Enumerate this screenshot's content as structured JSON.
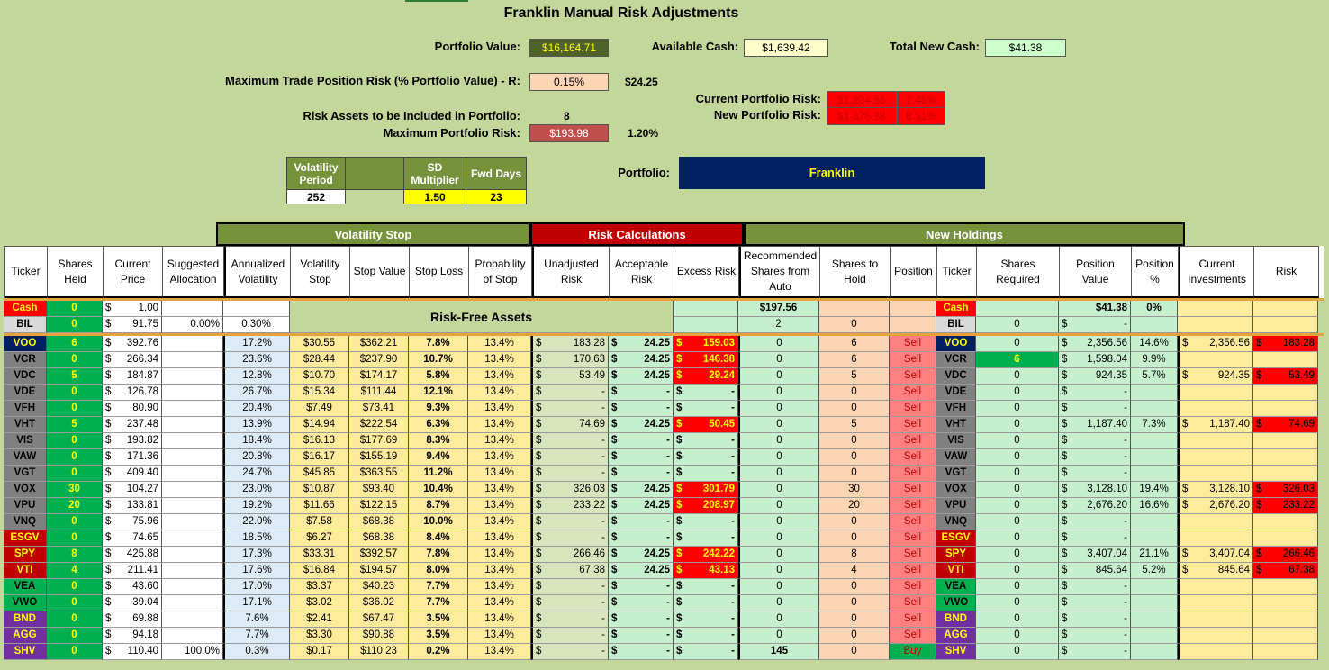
{
  "title": "Franklin Manual Risk Adjustments",
  "summary": {
    "portfolio_value_label": "Portfolio Value:",
    "portfolio_value": "$16,164.71",
    "available_cash_label": "Available Cash:",
    "available_cash": "$1,639.42",
    "total_new_cash_label": "Total New Cash:",
    "total_new_cash": "$41.38",
    "max_trade_label": "Maximum Trade Position Risk (% Portfolio Value) - R:",
    "max_trade_pct": "0.15%",
    "max_trade_amt": "$24.25",
    "current_risk_label": "Current Portfolio Risk:",
    "current_risk_amt": "$1,204.56",
    "current_risk_pct": "7.45%",
    "new_risk_label": "New Portfolio Risk:",
    "new_risk_amt": "$1,375.18",
    "new_risk_pct": "8.51%",
    "risk_assets_label": "Risk Assets to be Included in Portfolio:",
    "risk_assets": "8",
    "max_portfolio_risk_label": "Maximum Portfolio Risk:",
    "max_portfolio_risk": "$193.98",
    "max_portfolio_risk_pct": "1.20%",
    "portfolio_label": "Portfolio:",
    "portfolio_name": "Franklin"
  },
  "vol_table": {
    "h1": "Volatility Period",
    "h2": "",
    "h3": "SD Multiplier",
    "h4": "Fwd Days",
    "v1": "252",
    "v3": "1.50",
    "v4": "23"
  },
  "groups": {
    "vol_stop": "Volatility Stop",
    "risk_calc": "Risk Calculations",
    "new_holdings": "New Holdings"
  },
  "headers": [
    "Ticker",
    "Shares Held",
    "Current Price",
    "Suggested Allocation",
    "Annualized Volatility",
    "Volatility Stop",
    "Stop Value",
    "Stop Loss",
    "Probability of Stop",
    "Unadjusted Risk",
    "Acceptable Risk",
    "Excess Risk",
    "Recommended Shares from Auto",
    "Shares to Hold",
    "Position",
    "Ticker",
    "Shares Required",
    "Position Value",
    "Position %",
    "Current Investments",
    "Risk"
  ],
  "risk_free": {
    "label": "Risk-Free Assets",
    "cash": {
      "ticker": "Cash",
      "held": "0",
      "price": "1.00",
      "rec": "$197.56",
      "ticker2": "Cash",
      "pos_value": "$41.38",
      "pos_pct": "0%"
    },
    "bil": {
      "ticker": "BIL",
      "held": "0",
      "price": "91.75",
      "alloc": "0.00%",
      "vol": "0.30%",
      "rec": "2",
      "hold": "0",
      "ticker2": "BIL",
      "req": "0",
      "pos_value": "-"
    }
  },
  "rows": [
    {
      "t": "VOO",
      "held": "6",
      "price": "392.76",
      "vol": "17.2%",
      "vstop": "$30.55",
      "sval": "$362.21",
      "sloss": "7.8%",
      "prob": "13.4%",
      "unadj": "183.28",
      "acc": "24.25",
      "exc": "159.03",
      "rec": "0",
      "hold": "6",
      "pos": "Sell",
      "req": "0",
      "pval": "2,356.56",
      "ppct": "14.6%",
      "cur": "2,356.56",
      "risk": "183.28"
    },
    {
      "t": "VCR",
      "held": "0",
      "price": "266.34",
      "vol": "23.6%",
      "vstop": "$28.44",
      "sval": "$237.90",
      "sloss": "10.7%",
      "prob": "13.4%",
      "unadj": "170.63",
      "acc": "24.25",
      "exc": "146.38",
      "rec": "0",
      "hold": "6",
      "pos": "Sell",
      "req": "6",
      "pval": "1,598.04",
      "ppct": "9.9%",
      "cur": "",
      "risk": ""
    },
    {
      "t": "VDC",
      "held": "5",
      "price": "184.87",
      "vol": "12.8%",
      "vstop": "$10.70",
      "sval": "$174.17",
      "sloss": "5.8%",
      "prob": "13.4%",
      "unadj": "53.49",
      "acc": "24.25",
      "exc": "29.24",
      "rec": "0",
      "hold": "5",
      "pos": "Sell",
      "req": "0",
      "pval": "924.35",
      "ppct": "5.7%",
      "cur": "924.35",
      "risk": "53.49"
    },
    {
      "t": "VDE",
      "held": "0",
      "price": "126.78",
      "vol": "26.7%",
      "vstop": "$15.34",
      "sval": "$111.44",
      "sloss": "12.1%",
      "prob": "13.4%",
      "unadj": "-",
      "acc": "-",
      "exc": "-",
      "rec": "0",
      "hold": "0",
      "pos": "Sell",
      "req": "0",
      "pval": "-",
      "ppct": "",
      "cur": "",
      "risk": ""
    },
    {
      "t": "VFH",
      "held": "0",
      "price": "80.90",
      "vol": "20.4%",
      "vstop": "$7.49",
      "sval": "$73.41",
      "sloss": "9.3%",
      "prob": "13.4%",
      "unadj": "-",
      "acc": "-",
      "exc": "-",
      "rec": "0",
      "hold": "0",
      "pos": "Sell",
      "req": "0",
      "pval": "-",
      "ppct": "",
      "cur": "",
      "risk": ""
    },
    {
      "t": "VHT",
      "held": "5",
      "price": "237.48",
      "vol": "13.9%",
      "vstop": "$14.94",
      "sval": "$222.54",
      "sloss": "6.3%",
      "prob": "13.4%",
      "unadj": "74.69",
      "acc": "24.25",
      "exc": "50.45",
      "rec": "0",
      "hold": "5",
      "pos": "Sell",
      "req": "0",
      "pval": "1,187.40",
      "ppct": "7.3%",
      "cur": "1,187.40",
      "risk": "74.69"
    },
    {
      "t": "VIS",
      "held": "0",
      "price": "193.82",
      "vol": "18.4%",
      "vstop": "$16.13",
      "sval": "$177.69",
      "sloss": "8.3%",
      "prob": "13.4%",
      "unadj": "-",
      "acc": "-",
      "exc": "-",
      "rec": "0",
      "hold": "0",
      "pos": "Sell",
      "req": "0",
      "pval": "-",
      "ppct": "",
      "cur": "",
      "risk": ""
    },
    {
      "t": "VAW",
      "held": "0",
      "price": "171.36",
      "vol": "20.8%",
      "vstop": "$16.17",
      "sval": "$155.19",
      "sloss": "9.4%",
      "prob": "13.4%",
      "unadj": "-",
      "acc": "-",
      "exc": "-",
      "rec": "0",
      "hold": "0",
      "pos": "Sell",
      "req": "0",
      "pval": "-",
      "ppct": "",
      "cur": "",
      "risk": ""
    },
    {
      "t": "VGT",
      "held": "0",
      "price": "409.40",
      "vol": "24.7%",
      "vstop": "$45.85",
      "sval": "$363.55",
      "sloss": "11.2%",
      "prob": "13.4%",
      "unadj": "-",
      "acc": "-",
      "exc": "-",
      "rec": "0",
      "hold": "0",
      "pos": "Sell",
      "req": "0",
      "pval": "-",
      "ppct": "",
      "cur": "",
      "risk": ""
    },
    {
      "t": "VOX",
      "held": "30",
      "price": "104.27",
      "vol": "23.0%",
      "vstop": "$10.87",
      "sval": "$93.40",
      "sloss": "10.4%",
      "prob": "13.4%",
      "unadj": "326.03",
      "acc": "24.25",
      "exc": "301.79",
      "rec": "0",
      "hold": "30",
      "pos": "Sell",
      "req": "0",
      "pval": "3,128.10",
      "ppct": "19.4%",
      "cur": "3,128.10",
      "risk": "326.03"
    },
    {
      "t": "VPU",
      "held": "20",
      "price": "133.81",
      "vol": "19.2%",
      "vstop": "$11.66",
      "sval": "$122.15",
      "sloss": "8.7%",
      "prob": "13.4%",
      "unadj": "233.22",
      "acc": "24.25",
      "exc": "208.97",
      "rec": "0",
      "hold": "20",
      "pos": "Sell",
      "req": "0",
      "pval": "2,676.20",
      "ppct": "16.6%",
      "cur": "2,676.20",
      "risk": "233.22"
    },
    {
      "t": "VNQ",
      "held": "0",
      "price": "75.96",
      "vol": "22.0%",
      "vstop": "$7.58",
      "sval": "$68.38",
      "sloss": "10.0%",
      "prob": "13.4%",
      "unadj": "-",
      "acc": "-",
      "exc": "-",
      "rec": "0",
      "hold": "0",
      "pos": "Sell",
      "req": "0",
      "pval": "-",
      "ppct": "",
      "cur": "",
      "risk": ""
    },
    {
      "t": "ESGV",
      "held": "0",
      "price": "74.65",
      "vol": "18.5%",
      "vstop": "$6.27",
      "sval": "$68.38",
      "sloss": "8.4%",
      "prob": "13.4%",
      "unadj": "-",
      "acc": "-",
      "exc": "-",
      "rec": "0",
      "hold": "0",
      "pos": "Sell",
      "req": "0",
      "pval": "-",
      "ppct": "",
      "cur": "",
      "risk": ""
    },
    {
      "t": "SPY",
      "held": "8",
      "price": "425.88",
      "vol": "17.3%",
      "vstop": "$33.31",
      "sval": "$392.57",
      "sloss": "7.8%",
      "prob": "13.4%",
      "unadj": "266.46",
      "acc": "24.25",
      "exc": "242.22",
      "rec": "0",
      "hold": "8",
      "pos": "Sell",
      "req": "0",
      "pval": "3,407.04",
      "ppct": "21.1%",
      "cur": "3,407.04",
      "risk": "266.46"
    },
    {
      "t": "VTI",
      "held": "4",
      "price": "211.41",
      "vol": "17.6%",
      "vstop": "$16.84",
      "sval": "$194.57",
      "sloss": "8.0%",
      "prob": "13.4%",
      "unadj": "67.38",
      "acc": "24.25",
      "exc": "43.13",
      "rec": "0",
      "hold": "4",
      "pos": "Sell",
      "req": "0",
      "pval": "845.64",
      "ppct": "5.2%",
      "cur": "845.64",
      "risk": "67.38"
    },
    {
      "t": "VEA",
      "held": "0",
      "price": "43.60",
      "vol": "17.0%",
      "vstop": "$3.37",
      "sval": "$40.23",
      "sloss": "7.7%",
      "prob": "13.4%",
      "unadj": "-",
      "acc": "-",
      "exc": "-",
      "rec": "0",
      "hold": "0",
      "pos": "Sell",
      "req": "0",
      "pval": "-",
      "ppct": "",
      "cur": "",
      "risk": ""
    },
    {
      "t": "VWO",
      "held": "0",
      "price": "39.04",
      "vol": "17.1%",
      "vstop": "$3.02",
      "sval": "$36.02",
      "sloss": "7.7%",
      "prob": "13.4%",
      "unadj": "-",
      "acc": "-",
      "exc": "-",
      "rec": "0",
      "hold": "0",
      "pos": "Sell",
      "req": "0",
      "pval": "-",
      "ppct": "",
      "cur": "",
      "risk": ""
    },
    {
      "t": "BND",
      "held": "0",
      "price": "69.88",
      "vol": "7.6%",
      "vstop": "$2.41",
      "sval": "$67.47",
      "sloss": "3.5%",
      "prob": "13.4%",
      "unadj": "-",
      "acc": "-",
      "exc": "-",
      "rec": "0",
      "hold": "0",
      "pos": "Sell",
      "req": "0",
      "pval": "-",
      "ppct": "",
      "cur": "",
      "risk": ""
    },
    {
      "t": "AGG",
      "held": "0",
      "price": "94.18",
      "vol": "7.7%",
      "vstop": "$3.30",
      "sval": "$90.88",
      "sloss": "3.5%",
      "prob": "13.4%",
      "unadj": "-",
      "acc": "-",
      "exc": "-",
      "rec": "0",
      "hold": "0",
      "pos": "Sell",
      "req": "0",
      "pval": "-",
      "ppct": "",
      "cur": "",
      "risk": ""
    },
    {
      "t": "SHV",
      "held": "0",
      "price": "110.40",
      "alloc": "100.0%",
      "vol": "0.3%",
      "vstop": "$0.17",
      "sval": "$110.23",
      "sloss": "0.2%",
      "prob": "13.4%",
      "unadj": "-",
      "acc": "-",
      "exc": "-",
      "rec": "145",
      "hold": "0",
      "pos": "Buy",
      "req": "0",
      "pval": "-",
      "ppct": "",
      "cur": "",
      "risk": ""
    }
  ],
  "ticker_colors": {
    "VOO": "#002060",
    "VCR": "#808080",
    "VDC": "#808080",
    "VDE": "#808080",
    "VFH": "#808080",
    "VHT": "#808080",
    "VIS": "#808080",
    "VAW": "#808080",
    "VGT": "#808080",
    "VOX": "#808080",
    "VPU": "#808080",
    "VNQ": "#808080",
    "ESGV": "#c00000",
    "SPY": "#c00000",
    "VTI": "#c00000",
    "VEA": "#00b050",
    "VWO": "#00b050",
    "BND": "#7030a0",
    "AGG": "#7030a0",
    "SHV": "#7030a0"
  },
  "colors": {
    "background": "#c4d79b",
    "red": "#ff0000",
    "dark_red": "#c00000",
    "navy": "#002060",
    "yellow": "#ffff00",
    "light_green": "#c6efce",
    "tan": "#fcd5b4",
    "pale_yellow": "#ffeb9c"
  }
}
